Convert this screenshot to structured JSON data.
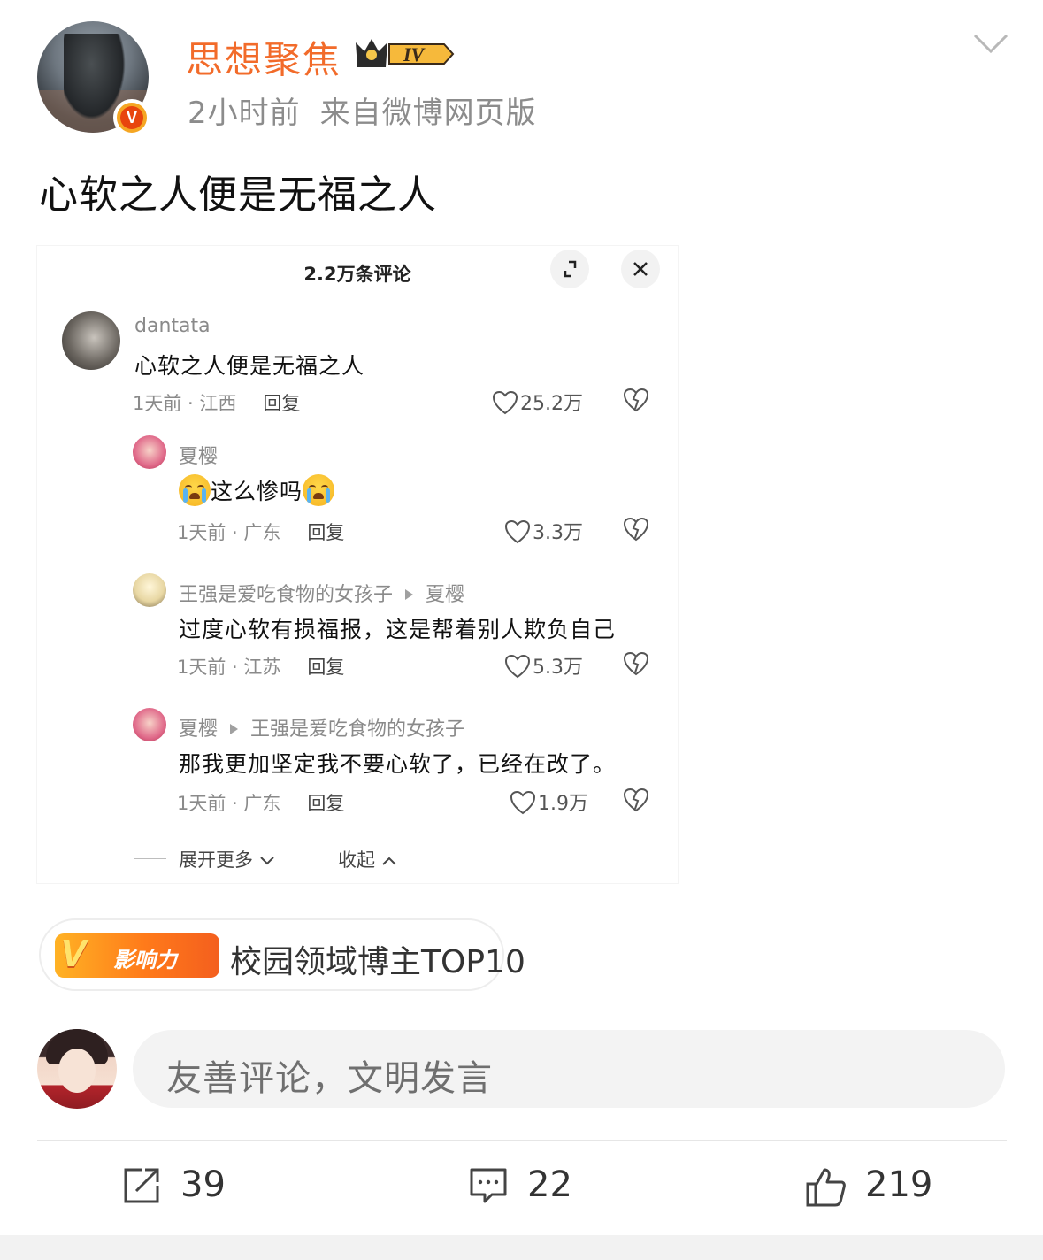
{
  "post": {
    "author_name": "思想聚焦",
    "level_badge": "IV",
    "time": "2小时前",
    "source": "来自微博网页版",
    "text": "心软之人便是无福之人"
  },
  "embed": {
    "title": "2.2万条评论",
    "comments": [
      {
        "name": "dantata",
        "reply_to": "",
        "text": "心软之人便是无福之人",
        "time": "1天前",
        "location": "江西",
        "reply_label": "回复",
        "likes": "25.2万"
      },
      {
        "name": "夏樱",
        "reply_to": "",
        "text": "这么惨吗",
        "time": "1天前",
        "location": "广东",
        "reply_label": "回复",
        "likes": "3.3万"
      },
      {
        "name": "王强是爱吃食物的女孩子",
        "reply_to": "夏樱",
        "text": "过度心软有损福报，这是帮着别人欺负自己",
        "time": "1天前",
        "location": "江苏",
        "reply_label": "回复",
        "likes": "5.3万"
      },
      {
        "name": "夏樱",
        "reply_to": "王强是爱吃食物的女孩子",
        "text": "那我更加坚定我不要心软了，已经在改了。",
        "time": "1天前",
        "location": "广东",
        "reply_label": "回复",
        "likes": "1.9万"
      }
    ],
    "expand_more": "展开更多",
    "collapse": "收起"
  },
  "influence": {
    "badge_text": "影响力",
    "text": "校园领域博主TOP10"
  },
  "comment_input": {
    "placeholder": "友善评论，文明发言"
  },
  "actions": {
    "repost_count": "39",
    "comment_count": "22",
    "like_count": "219"
  },
  "colors": {
    "author_name": "#f26b2a",
    "meta_gray": "#8c8c8c",
    "input_bg": "#f3f3f3"
  }
}
